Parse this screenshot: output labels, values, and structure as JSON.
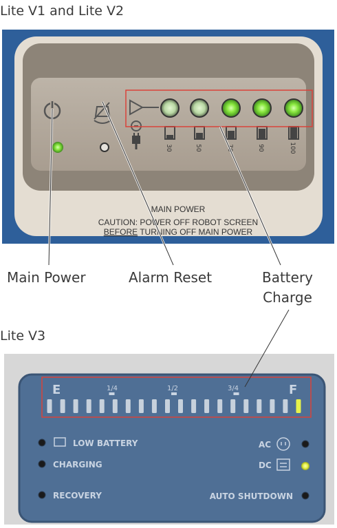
{
  "headings": {
    "v1v2": "Lite V1 and Lite V2",
    "v3": "Lite V3"
  },
  "callouts": {
    "main_power": "Main Power",
    "alarm_reset": "Alarm Reset",
    "battery_charge_line1": "Battery",
    "battery_charge_line2": "Charge"
  },
  "panel_v1v2": {
    "main_power_label": "MAIN POWER",
    "caution_line1": "CAUTION: POWER OFF ROBOT SCREEN",
    "caution_line2_emph": "BEFORE",
    "caution_line2_rest": " TURNING OFF MAIN POWER",
    "battery_levels": [
      "30",
      "50",
      "70",
      "90",
      "100"
    ],
    "battery_leds_lit": [
      false,
      false,
      true,
      true,
      true
    ],
    "main_power_led_lit": true,
    "alarm_led_lit": false
  },
  "panel_v3": {
    "empty_label": "E",
    "full_label": "F",
    "tick_labels": [
      "1/4",
      "1/2",
      "3/4"
    ],
    "segment_count": 20,
    "lit_segments": 1,
    "low_battery": "LOW BATTERY",
    "charging": "CHARGING",
    "recovery": "RECOVERY",
    "ac": "AC",
    "dc": "DC",
    "auto_shutdown": "AUTO SHUTDOWN",
    "dc_led_lit": true
  },
  "colors": {
    "highlight_box": "#d9433a",
    "led_green": "#7fe13a",
    "led_yellow": "#e6f24a",
    "panel_v3_blue": "#4f6f95"
  }
}
